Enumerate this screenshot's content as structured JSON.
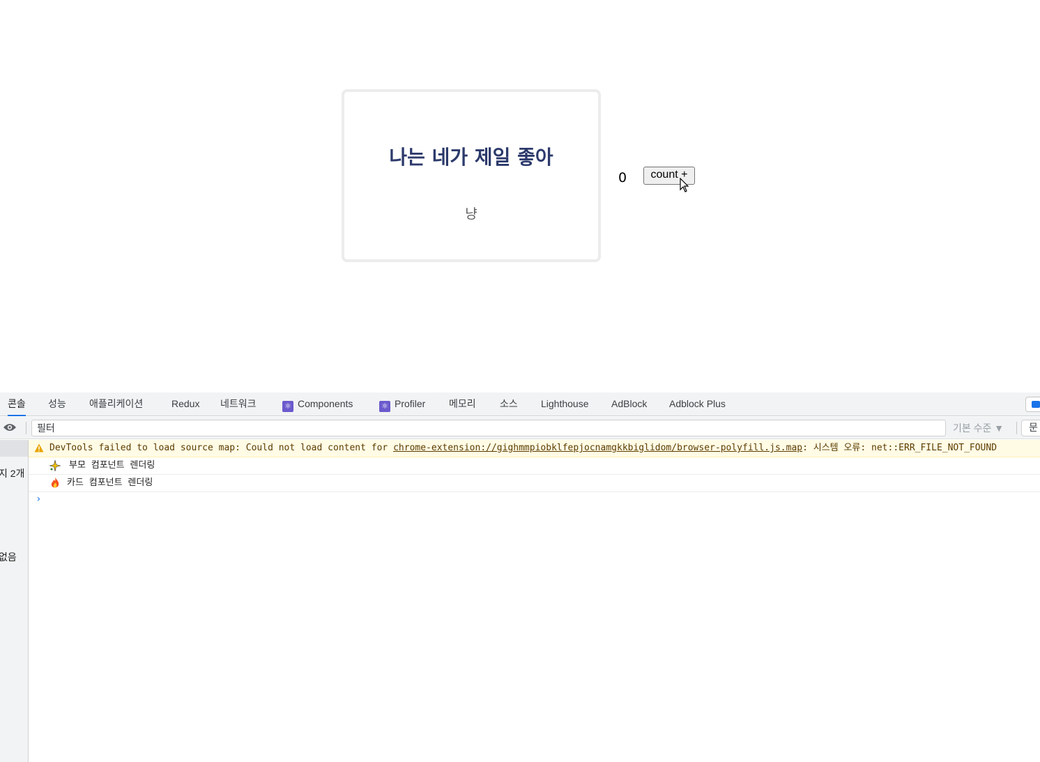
{
  "page": {
    "card": {
      "title": "나는 네가 제일 좋아",
      "body": "냥"
    },
    "count": {
      "value": "0",
      "button_label": "count +"
    }
  },
  "devtools": {
    "tabs": [
      {
        "label": "콘솔",
        "active": true
      },
      {
        "label": "성능"
      },
      {
        "label": "애플리케이션"
      },
      {
        "label": "Redux"
      },
      {
        "label": "네트워크"
      },
      {
        "label": "Components",
        "icon": "react-icon"
      },
      {
        "label": "Profiler",
        "icon": "react-icon"
      },
      {
        "label": "메모리"
      },
      {
        "label": "소스"
      },
      {
        "label": "Lighthouse"
      },
      {
        "label": "AdBlock"
      },
      {
        "label": "Adblock Plus"
      }
    ],
    "filter": {
      "placeholder": "필터"
    },
    "level_select": "기본 수준 ▼",
    "issues_label": "문",
    "sidebar": {
      "messages_label": "지 2개",
      "none_label": "없음"
    },
    "console": {
      "warning": {
        "prefix": "DevTools failed to load source map: Could not load content for ",
        "link": "chrome-extension://gighmmpiobklfepjocnamgkkbiglidom/browser-polyfill.js.map",
        "suffix": ": 시스템 오류: net::ERR_FILE_NOT_FOUND"
      },
      "logs": [
        {
          "icon": "sparkle-icon",
          "text": "부모 컴포넌트 렌더링"
        },
        {
          "icon": "fire-icon",
          "text": "카드 컴포넌트 렌더링"
        }
      ],
      "prompt": "›"
    },
    "colors": {
      "accent": "#1a73e8",
      "warning_bg": "#fffbe5",
      "card_title": "#2c3a6b"
    }
  }
}
